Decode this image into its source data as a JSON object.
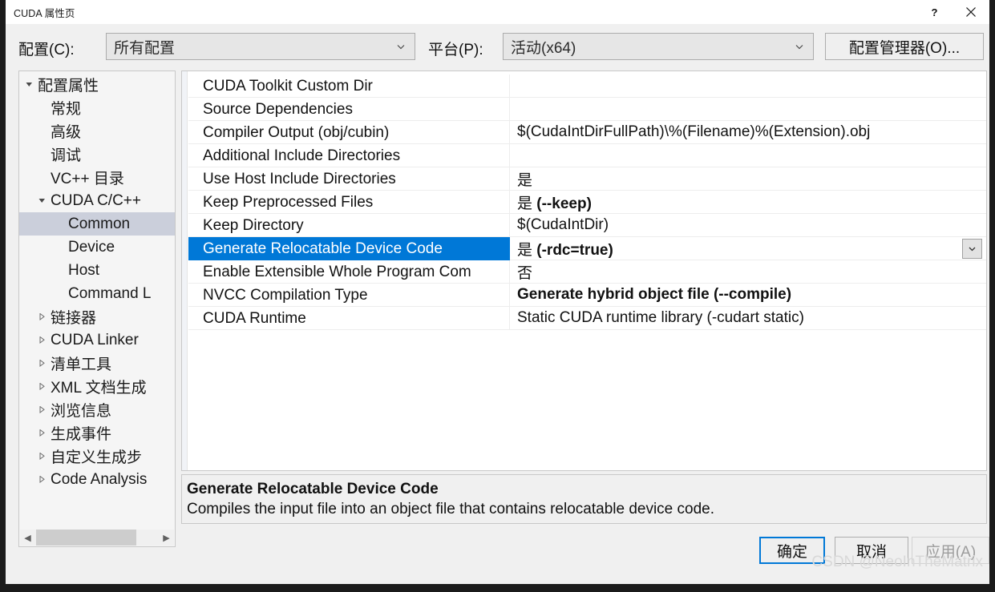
{
  "window": {
    "title": "CUDA 属性页",
    "help_icon": "question-mark-icon",
    "close_icon": "close-icon",
    "help_label": "?",
    "close_label": "✕"
  },
  "config_bar": {
    "configuration_label": "配置(C):",
    "configuration_value": "所有配置",
    "platform_label": "平台(P):",
    "platform_value": "活动(x64)",
    "config_manager_button": "配置管理器(O)...",
    "dropdown_icon": "chevron-down-icon"
  },
  "tree": {
    "items": [
      {
        "label": "配置属性",
        "indent": 0,
        "arrow": "expanded",
        "selected": false
      },
      {
        "label": "常规",
        "indent": 1,
        "arrow": "none",
        "selected": false
      },
      {
        "label": "高级",
        "indent": 1,
        "arrow": "none",
        "selected": false
      },
      {
        "label": "调试",
        "indent": 1,
        "arrow": "none",
        "selected": false
      },
      {
        "label": "VC++ 目录",
        "indent": 1,
        "arrow": "none",
        "selected": false
      },
      {
        "label": "CUDA C/C++",
        "indent": 1,
        "arrow": "expanded",
        "selected": false
      },
      {
        "label": "Common",
        "indent": 2,
        "arrow": "none",
        "selected": true
      },
      {
        "label": "Device",
        "indent": 2,
        "arrow": "none",
        "selected": false
      },
      {
        "label": "Host",
        "indent": 2,
        "arrow": "none",
        "selected": false
      },
      {
        "label": "Command L",
        "indent": 2,
        "arrow": "none",
        "selected": false
      },
      {
        "label": "链接器",
        "indent": 1,
        "arrow": "collapsed",
        "selected": false
      },
      {
        "label": "CUDA Linker",
        "indent": 1,
        "arrow": "collapsed",
        "selected": false
      },
      {
        "label": "清单工具",
        "indent": 1,
        "arrow": "collapsed",
        "selected": false
      },
      {
        "label": "XML 文档生成",
        "indent": 1,
        "arrow": "collapsed",
        "selected": false
      },
      {
        "label": "浏览信息",
        "indent": 1,
        "arrow": "collapsed",
        "selected": false
      },
      {
        "label": "生成事件",
        "indent": 1,
        "arrow": "collapsed",
        "selected": false
      },
      {
        "label": "自定义生成步",
        "indent": 1,
        "arrow": "collapsed",
        "selected": false
      },
      {
        "label": "Code Analysis",
        "indent": 1,
        "arrow": "collapsed",
        "selected": false
      }
    ],
    "scroll_left_icon": "chevron-left-icon",
    "scroll_right_icon": "chevron-right-icon"
  },
  "grid": {
    "rows": [
      {
        "name": "CUDA Toolkit Custom Dir",
        "value": "",
        "value_bold": "",
        "bold": false,
        "selected": false
      },
      {
        "name": "Source Dependencies",
        "value": "",
        "value_bold": "",
        "bold": false,
        "selected": false
      },
      {
        "name": "Compiler Output (obj/cubin)",
        "value": "$(CudaIntDirFullPath)\\%(Filename)%(Extension).obj",
        "value_bold": "",
        "bold": false,
        "selected": false
      },
      {
        "name": "Additional Include Directories",
        "value": "",
        "value_bold": "",
        "bold": false,
        "selected": false
      },
      {
        "name": "Use Host Include Directories",
        "value": "是",
        "value_bold": "",
        "bold": false,
        "selected": false
      },
      {
        "name": "Keep Preprocessed Files",
        "value": "是 ",
        "value_bold": "(--keep)",
        "bold": false,
        "selected": false
      },
      {
        "name": "Keep Directory",
        "value": "$(CudaIntDir)",
        "value_bold": "",
        "bold": false,
        "selected": false
      },
      {
        "name": "Generate Relocatable Device Code",
        "value": "是 ",
        "value_bold": "(-rdc=true)",
        "bold": false,
        "selected": true
      },
      {
        "name": "Enable Extensible Whole Program Com",
        "value": "否",
        "value_bold": "",
        "bold": false,
        "selected": false
      },
      {
        "name": "NVCC Compilation Type",
        "value": "",
        "value_bold": "Generate hybrid object file (--compile)",
        "bold": false,
        "selected": false
      },
      {
        "name": "CUDA Runtime",
        "value": "Static CUDA runtime library (-cudart static)",
        "value_bold": "",
        "bold": false,
        "selected": false
      }
    ],
    "row_dropdown_icon": "chevron-down-icon"
  },
  "description": {
    "title": "Generate Relocatable Device Code",
    "body": "Compiles the input file into an object file that contains relocatable device code."
  },
  "footer": {
    "ok_label": "确定",
    "cancel_label": "取消",
    "apply_label": "应用(A)"
  },
  "watermark": {
    "text": "CSDN @NeoInTheMatrix"
  },
  "colors": {
    "selection_blue": "#0078D7",
    "tree_selection": "#CBCFDB",
    "dialog_bg": "#F0F0F0",
    "grid_bg": "#FFFFFF"
  }
}
